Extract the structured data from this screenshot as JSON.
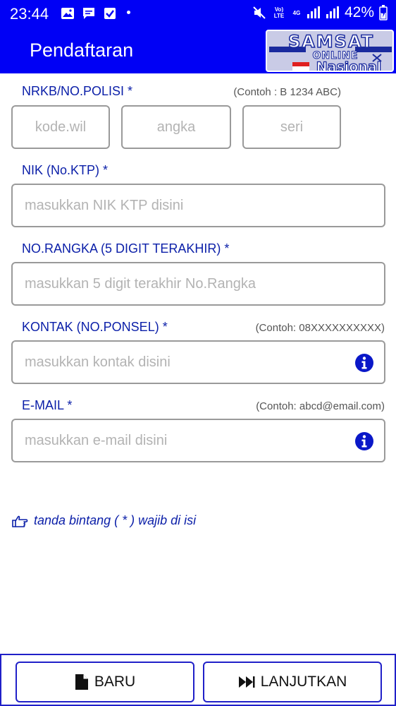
{
  "status_bar": {
    "time": "23:44",
    "battery": "42%",
    "network_top": "Vo) LTE",
    "network_4g": "4G"
  },
  "app_bar": {
    "title": "Pendaftaran",
    "logo_lines": [
      "SAMSAT",
      "ONLINE",
      "Nasional"
    ]
  },
  "form": {
    "nrkb": {
      "label": "NRKB/NO.POLISI *",
      "example": "(Contoh : B 1234 ABC)",
      "kode_placeholder": "kode.wil",
      "angka_placeholder": "angka",
      "seri_placeholder": "seri"
    },
    "nik": {
      "label": "NIK (No.KTP) *",
      "placeholder": "masukkan NIK KTP disini"
    },
    "rangka": {
      "label": "NO.RANGKA (5 DIGIT TERAKHIR) *",
      "placeholder": "masukkan 5 digit terakhir No.Rangka"
    },
    "kontak": {
      "label": "KONTAK (NO.PONSEL) *",
      "example": "(Contoh: 08XXXXXXXXXX)",
      "placeholder": "masukkan kontak disini"
    },
    "email": {
      "label": "E-MAIL *",
      "example": "(Contoh: abcd@email.com)",
      "placeholder": "masukkan e-mail disini"
    },
    "hint": "tanda bintang ( * ) wajib di isi"
  },
  "buttons": {
    "new_label": "BARU",
    "continue_label": "LANJUTKAN"
  },
  "colors": {
    "primary": "#0000f5",
    "label": "#0a1ea8",
    "button_border": "#2020c8"
  },
  "icons": [
    "image-icon",
    "message-icon",
    "checkbox-icon",
    "mute-icon",
    "signal-icon",
    "battery-icon",
    "info-icon",
    "hand-point-icon",
    "file-icon",
    "fast-forward-icon"
  ]
}
